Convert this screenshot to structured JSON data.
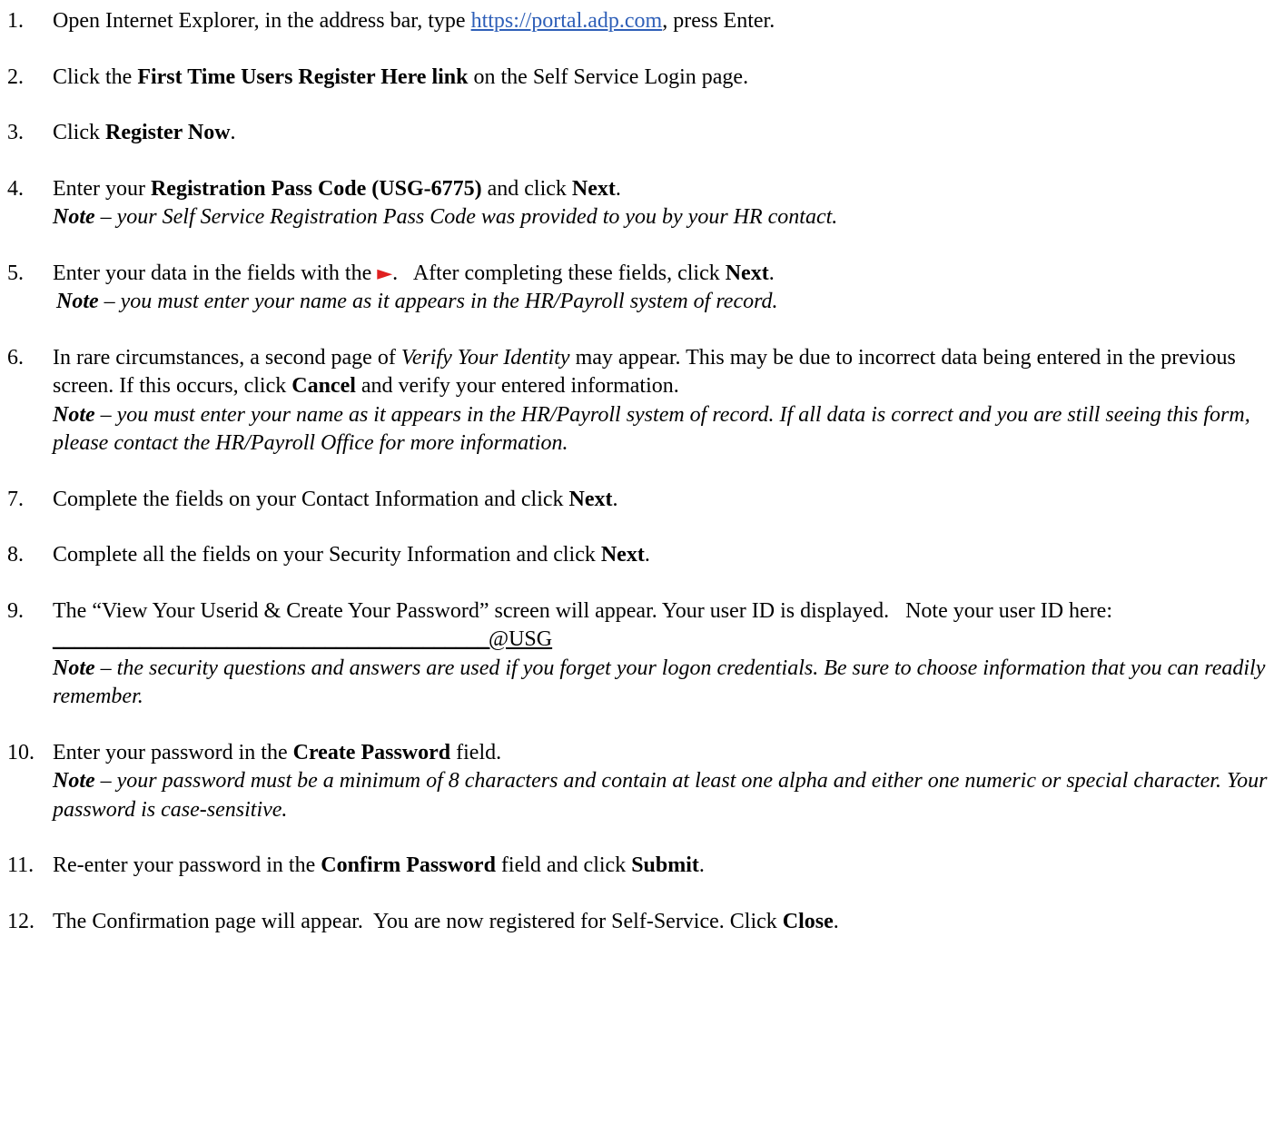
{
  "steps": [
    {
      "num": "1.",
      "pre": "Open Internet Explorer, in the address bar, type ",
      "link": "https://portal.adp.com",
      "post": ", press Enter."
    },
    {
      "num": "2.",
      "pre": "Click the ",
      "bold": "First Time Users Register Here link",
      "post": " on the Self Service Login page."
    },
    {
      "num": "3.",
      "pre": "Click ",
      "bold": "Register Now",
      "post": "."
    },
    {
      "num": "4.",
      "pre": "Enter your ",
      "bold1": "Registration Pass Code (USG-6775)",
      "mid": " and click ",
      "bold2": "Next",
      "post": ".",
      "note_label": "Note",
      "note_text": " – your Self Service Registration Pass Code was provided to you by your HR contact."
    },
    {
      "num": "5.",
      "pre": "Enter your data in the fields with the ",
      "arrow": "►",
      "mid": ".   After completing these fields, click ",
      "bold": "Next",
      "post": ".",
      "note_label": "Note",
      "note_text": " – you must enter your name as it appears in the HR/Payroll system of record."
    },
    {
      "num": "6.",
      "pre": "In rare circumstances, a second page of ",
      "italic": "Verify Your Identity",
      "mid": " may appear. This may be due to incorrect data being entered in the previous screen. If this occurs, click ",
      "bold": "Cancel",
      "post": " and verify your entered information.",
      "note_label": "Note",
      "note_text": " – you must enter your name as it appears in the HR/Payroll system of record. If all data is correct and you are still seeing this form, please contact the HR/Payroll Office for more information."
    },
    {
      "num": "7.",
      "pre": "Complete the fields on your Contact Information and click ",
      "bold": "Next",
      "post": "."
    },
    {
      "num": "8.",
      "pre": "Complete all the fields on your Security Information and click ",
      "bold": "Next",
      "post": "."
    },
    {
      "num": "9.",
      "pre": "The “View Your Userid & Create Your Password” screen will appear. Your user ID is displayed.   Note your user ID here:  ",
      "blank": "________________________________________",
      "suffix": "@USG",
      "note_label": "Note",
      "note_text": " – the security questions and answers are used if you forget your logon credentials. Be sure to choose information that you can readily remember."
    },
    {
      "num": "10.",
      "pre": "Enter your password in the ",
      "bold": "Create Password",
      "post": " field.",
      "note_label": "Note",
      "note_text": " – your password must be a minimum of 8 characters and contain at least one alpha and either one numeric or special character. Your password is case-sensitive."
    },
    {
      "num": "11.",
      "pre": "Re-enter your password in the ",
      "bold1": "Confirm Password",
      "mid": " field and click ",
      "bold2": "Submit",
      "post": "."
    },
    {
      "num": "12.",
      "pre": "The Confirmation page will appear.  You are now registered for Self-Service. Click ",
      "bold": "Close",
      "post": "."
    }
  ]
}
